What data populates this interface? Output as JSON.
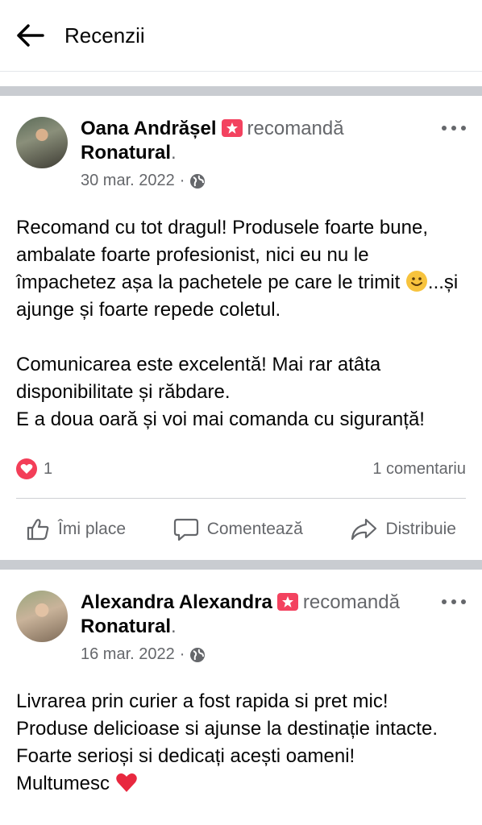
{
  "header": {
    "title": "Recenzii"
  },
  "posts": [
    {
      "author": "Oana Andrășel",
      "verb": "recomandă",
      "page": "Ronatural",
      "date": "30 mar. 2022",
      "text_p1": "Recomand cu tot dragul! Produsele foarte bune, ambalate foarte profesionist, nici eu nu le împachetez așa la pachetele pe care le trimit ",
      "text_p1b": "...și ajunge și foarte repede coletul.",
      "text_p2": "Comunicarea este excelentă! Mai rar atâta disponibilitate și răbdare.\nE a doua oară și voi mai comanda cu siguranță!",
      "reactions": "1",
      "comments": "1 comentariu",
      "actions": {
        "like": "Îmi place",
        "comment": "Comentează",
        "share": "Distribuie"
      }
    },
    {
      "author": "Alexandra Alexandra",
      "verb": "recomandă",
      "page": "Ronatural",
      "date": "16 mar. 2022",
      "text": "Livrarea prin curier a fost rapida si pret mic!\nProduse delicioase si ajunse la destinație intacte.\nFoarte serioși si dedicați acești oameni!\nMultumesc "
    }
  ],
  "colors": {
    "recommend_badge": "#f3425f",
    "heart": "#f33e58",
    "separator": "#c9ccd1",
    "secondary_text": "#65676b"
  },
  "icons": [
    "back-arrow-icon",
    "recommend-icon",
    "globe-icon",
    "more-icon",
    "heart-icon",
    "like-icon",
    "comment-icon",
    "share-icon",
    "smile-emoji-icon",
    "red-heart-emoji-icon"
  ]
}
